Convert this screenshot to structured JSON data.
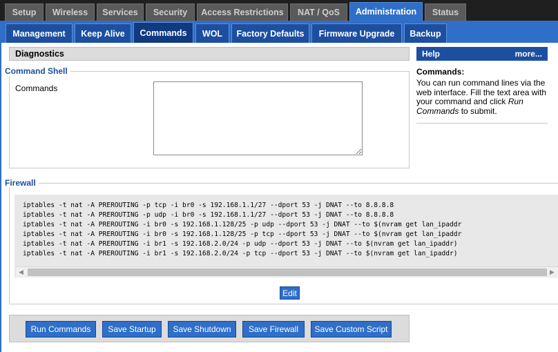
{
  "top_tabs": [
    {
      "label": "Setup",
      "active": false
    },
    {
      "label": "Wireless",
      "active": false
    },
    {
      "label": "Services",
      "active": false
    },
    {
      "label": "Security",
      "active": false
    },
    {
      "label": "Access Restrictions",
      "active": false
    },
    {
      "label": "NAT / QoS",
      "active": false
    },
    {
      "label": "Administration",
      "active": true
    },
    {
      "label": "Status",
      "active": false
    }
  ],
  "sub_tabs": [
    {
      "label": "Management",
      "active": false
    },
    {
      "label": "Keep Alive",
      "active": false
    },
    {
      "label": "Commands",
      "active": true
    },
    {
      "label": "WOL",
      "active": false
    },
    {
      "label": "Factory Defaults",
      "active": false
    },
    {
      "label": "Firmware Upgrade",
      "active": false
    },
    {
      "label": "Backup",
      "active": false
    }
  ],
  "section_title": "Diagnostics",
  "command_shell": {
    "legend": "Command Shell",
    "commands_label": "Commands",
    "commands_value": ""
  },
  "firewall": {
    "legend": "Firewall",
    "lines": [
      "iptables -t nat -A PREROUTING -p tcp -i br0 -s 192.168.1.1/27 --dport 53 -j DNAT --to 8.8.8.8",
      "iptables -t nat -A PREROUTING -p udp -i br0 -s 192.168.1.1/27 --dport 53 -j DNAT --to 8.8.8.8",
      "iptables -t nat -A PREROUTING -i br0 -s 192.168.1.128/25 -p udp --dport 53 -j DNAT --to $(nvram get lan_ipaddr",
      "iptables -t nat -A PREROUTING -i br0 -s 192.168.1.128/25 -p tcp --dport 53 -j DNAT --to $(nvram get lan_ipaddr",
      "iptables -t nat -A PREROUTING -i br1 -s 192.168.2.0/24 -p udp --dport 53 -j DNAT --to $(nvram get lan_ipaddr)",
      "iptables -t nat -A PREROUTING -i br1 -s 192.168.2.0/24 -p tcp --dport 53 -j DNAT --to $(nvram get lan_ipaddr)"
    ],
    "edit_label": "Edit"
  },
  "buttons": {
    "run": "Run Commands",
    "save_startup": "Save Startup",
    "save_shutdown": "Save Shutdown",
    "save_firewall": "Save Firewall",
    "save_custom": "Save Custom Script"
  },
  "help": {
    "title": "Help",
    "more": "more...",
    "heading": "Commands:",
    "text_1": "You can run command lines via the web interface. Fill the text area with your command and click ",
    "text_em": "Run Commands",
    "text_2": " to submit."
  },
  "colors": {
    "accent": "#2f6fc9",
    "dark_accent": "#1c4fa0",
    "tab_inactive": "#5a5a5a"
  }
}
